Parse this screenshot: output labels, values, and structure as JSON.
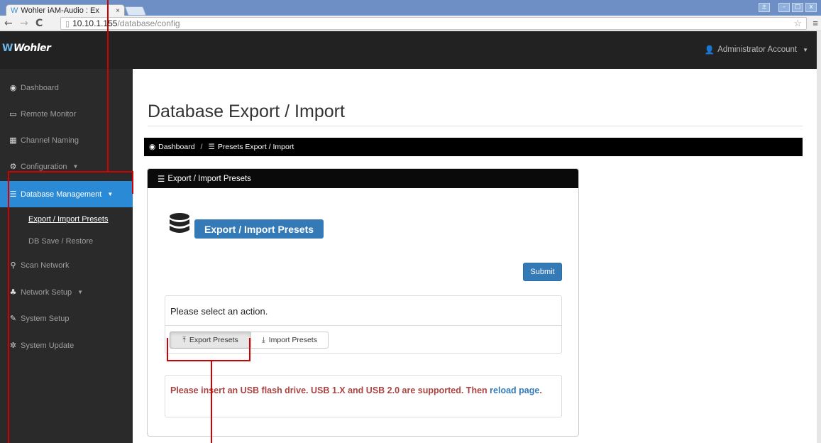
{
  "browser": {
    "tab_title": "Wohler iAM-Audio : Ex",
    "tab_close": "×",
    "url_host": "10.10.1.155",
    "url_path": "/database/config",
    "back": "←",
    "forward": "→",
    "reload": "C",
    "window_controls": [
      "±",
      "–",
      "□",
      "x"
    ]
  },
  "navbar": {
    "logo_text": "Wohler",
    "account_label": "Administrator Account"
  },
  "sidebar": {
    "items": [
      {
        "label": "Dashboard",
        "icon": "dashboard-icon"
      },
      {
        "label": "Remote Monitor",
        "icon": "monitor-icon"
      },
      {
        "label": "Channel Naming",
        "icon": "table-icon"
      },
      {
        "label": "Configuration",
        "icon": "cogs-icon"
      },
      {
        "label": "Database Management",
        "icon": "database-icon"
      },
      {
        "label": "Export / Import Presets"
      },
      {
        "label": "DB Save / Restore"
      },
      {
        "label": "Scan Network",
        "icon": "search-icon"
      },
      {
        "label": "Network Setup",
        "icon": "sitemap-icon"
      },
      {
        "label": "System Setup",
        "icon": "wrench-icon"
      },
      {
        "label": "System Update",
        "icon": "gear-icon"
      }
    ]
  },
  "main": {
    "title": "Database Export / Import",
    "breadcrumb": {
      "home": "Dashboard",
      "separator": "/",
      "current": "Presets Export / Import"
    },
    "panel": {
      "heading": "Export / Import Presets",
      "big_label": "Export / Import Presets",
      "submit_label": "Submit",
      "action_prompt": "Please select an action.",
      "export_label": "Export Presets",
      "import_label": "Import Presets",
      "warning_text": "Please insert an USB flash drive. USB 1.X and USB 2.0 are supported. Then",
      "reload_link": "reload page",
      "warning_end": "."
    }
  },
  "colors": {
    "accent": "#337ab7",
    "sidebar_active": "#2b8ad5",
    "warning": "#a94442",
    "annotation": "#d00000"
  }
}
